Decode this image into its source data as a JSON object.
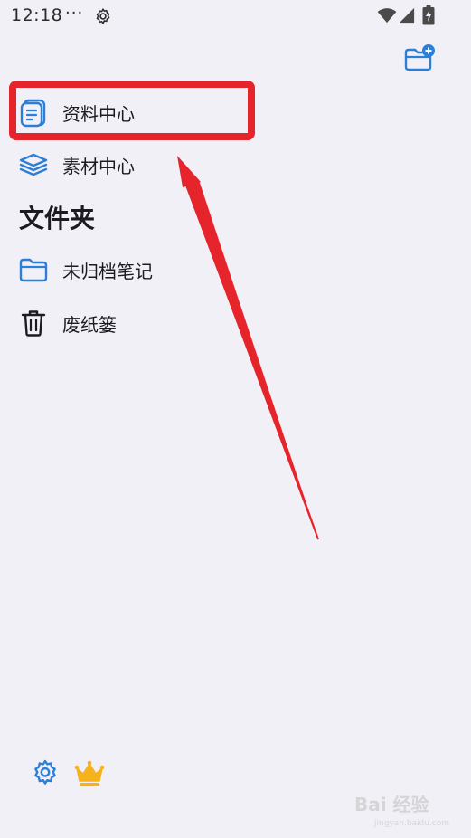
{
  "status_bar": {
    "time": "12:18",
    "dots": "···",
    "icons": [
      "gear-icon",
      "wifi-icon",
      "signal-icon",
      "battery-charging-icon"
    ]
  },
  "header": {
    "action_icon": "new-folder-icon"
  },
  "drawer": {
    "items": [
      {
        "label": "资料中心",
        "icon": "library-icon",
        "highlighted": true
      },
      {
        "label": "素材中心",
        "icon": "layers-icon"
      }
    ],
    "section_title": "文件夹",
    "folders": [
      {
        "label": "未归档笔记",
        "icon": "folder-icon"
      },
      {
        "label": "废纸篓",
        "icon": "trash-icon"
      }
    ]
  },
  "footer": {
    "icons": [
      "settings-icon",
      "crown-icon"
    ]
  },
  "colors": {
    "background": "#f2f0f7",
    "accent": "#2b7fd6",
    "annotation": "#e5242b",
    "crown": "#f6b21b"
  },
  "watermark": {
    "text": "Bai 经验",
    "sub": "jingyan.baidu.com"
  }
}
